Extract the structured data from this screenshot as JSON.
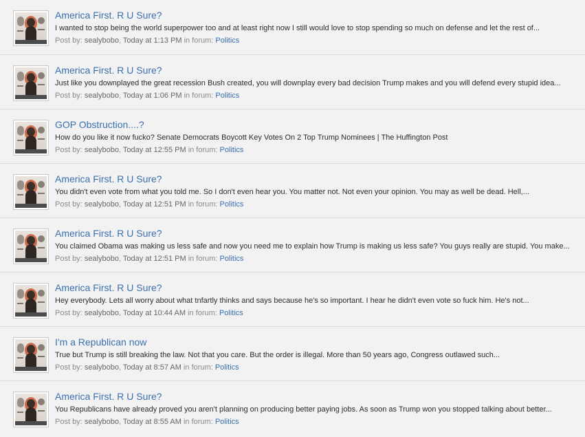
{
  "labels": {
    "post_by": "Post by:",
    "in_forum": "in forum:"
  },
  "results": [
    {
      "title": "America First. R U Sure?",
      "snippet": "I wanted to stop being the world superpower too and at least right now I still would love to stop spending so much on defense and let the rest of...",
      "author": "sealybobo",
      "time": "Today at 1:13 PM",
      "forum": "Politics"
    },
    {
      "title": "America First. R U Sure?",
      "snippet": "Just like you downplayed the great recession Bush created, you will downplay every bad decision Trump makes and you will defend every stupid idea...",
      "author": "sealybobo",
      "time": "Today at 1:06 PM",
      "forum": "Politics"
    },
    {
      "title": "GOP Obstruction....?",
      "snippet": "How do you like it now fucko? Senate Democrats Boycott Key Votes On 2 Top Trump Nominees | The Huffington Post",
      "author": "sealybobo",
      "time": "Today at 12:55 PM",
      "forum": "Politics"
    },
    {
      "title": "America First. R U Sure?",
      "snippet": "You didn't even vote from what you told me. So I don't even hear you. You matter not. Not even your opinion. You may as well be dead. Hell,...",
      "author": "sealybobo",
      "time": "Today at 12:51 PM",
      "forum": "Politics"
    },
    {
      "title": "America First. R U Sure?",
      "snippet": "You claimed Obama was making us less safe and now you need me to explain how Trump is making us less safe? You guys really are stupid. You make...",
      "author": "sealybobo",
      "time": "Today at 12:51 PM",
      "forum": "Politics"
    },
    {
      "title": "America First. R U Sure?",
      "snippet": "Hey everybody. Lets all worry about what tnfartly thinks and says because he's so important. I hear he didn't even vote so fuck him. He's not...",
      "author": "sealybobo",
      "time": "Today at 10:44 AM",
      "forum": "Politics"
    },
    {
      "title": "I'm a Republican now",
      "snippet": "True but Trump is still breaking the law. Not that you care. But the order is illegal. More than 50 years ago, Congress outlawed such...",
      "author": "sealybobo",
      "time": "Today at 8:57 AM",
      "forum": "Politics"
    },
    {
      "title": "America First. R U Sure?",
      "snippet": "You Republicans have already proved you aren't planning on producing better paying jobs. As soon as Trump won you stopped talking about better...",
      "author": "sealybobo",
      "time": "Today at 8:55 AM",
      "forum": "Politics"
    }
  ]
}
